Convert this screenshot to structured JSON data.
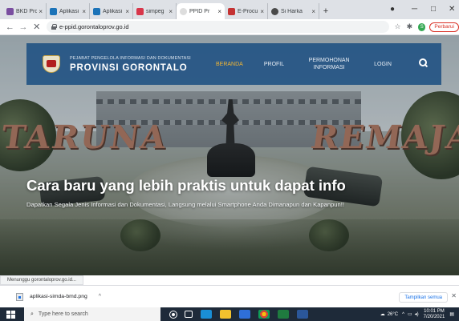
{
  "tabs": [
    {
      "title": "BKD Pro",
      "color": "#7a4ea0"
    },
    {
      "title": "Aplikasi",
      "color": "#1b73b8"
    },
    {
      "title": "Aplikasi",
      "color": "#1b73b8"
    },
    {
      "title": "simpeg",
      "color": "#d8364a"
    },
    {
      "title": "PPID Pr",
      "color": "#ffffff"
    },
    {
      "title": "E-Procu",
      "color": "#c43232"
    },
    {
      "title": "Si Harka",
      "color": "#4a4a4a"
    }
  ],
  "address": {
    "url": "e-ppid.gorontaloprov.go.id",
    "update_label": "Perbarui"
  },
  "site": {
    "org_sub": "PEJABAT PENGELOLA INFORMASI DAN DOKUMENTASI",
    "org_main": "PROVINSI GORONTALO",
    "menu": {
      "beranda": "BERANDA",
      "profil": "PROFIL",
      "permohonan": "PERMOHONAN INFORMASI",
      "login": "LOGIN"
    }
  },
  "hero": {
    "sign_left": "TARUNA",
    "sign_right": "REMAJA",
    "headline": "Cara baru yang lebih praktis untuk dapat info",
    "description": "Dapatkan Segala Jenis Informasi dan Dokumentasi, Langsung melalui Smartphone Anda Dimanapun dan Kapanpun!!"
  },
  "status": "Menunggu gorontaloprov.go.id...",
  "downloads": {
    "file": "aplikasi-simda-bmd.png",
    "show_all": "Tampilkan semua"
  },
  "taskbar": {
    "search_placeholder": "Type here to search",
    "temp": "26°C",
    "time": "10:01 PM",
    "date": "7/20/2021"
  },
  "colors": {
    "header_blue": "#1e5082",
    "active_menu": "#f2b634",
    "update_red": "#d93025"
  }
}
